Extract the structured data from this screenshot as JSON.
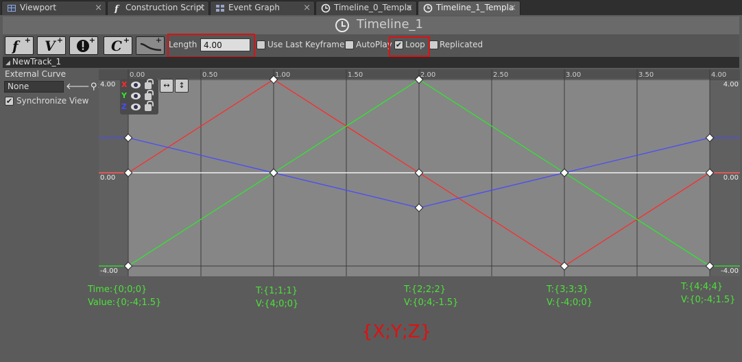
{
  "tabs": [
    {
      "label": "Viewport",
      "icon": "viewport-icon",
      "closable": true,
      "active": false
    },
    {
      "label": "Construction Script",
      "icon": "function-icon",
      "closable": true,
      "active": false
    },
    {
      "label": "Event Graph",
      "icon": "graph-icon",
      "closable": true,
      "active": false
    },
    {
      "label": "Timeline_0_Templa",
      "icon": "clock-icon",
      "closable": true,
      "active": false
    },
    {
      "label": "Timeline_1_Templa",
      "icon": "clock-icon",
      "closable": true,
      "active": true
    }
  ],
  "title": "Timeline_1",
  "toolbar": {
    "buttons": [
      {
        "glyph": "f",
        "icon": "add-float-track-icon"
      },
      {
        "glyph": "V",
        "icon": "add-vector-track-icon"
      },
      {
        "glyph": "!",
        "icon": "add-event-track-icon"
      },
      {
        "glyph": "C",
        "icon": "add-color-track-icon"
      },
      {
        "glyph": "",
        "icon": "add-external-curve-icon"
      }
    ],
    "length_label": "Length",
    "length_value": "4.00",
    "use_last_keyframe_label": "Use Last Keyframe?",
    "use_last_keyframe": false,
    "autoplay_label": "AutoPlay",
    "autoplay": false,
    "loop_label": "Loop",
    "loop": true,
    "replicated_label": "Replicated",
    "replicated": false
  },
  "track": {
    "name": "NewTrack_1",
    "external_curve_label": "External Curve",
    "external_curve_value": "None",
    "sync_view_label": "Synchronize View",
    "sync_view": true
  },
  "axis_toggles": [
    {
      "label": "X",
      "color": "#ff2a2a"
    },
    {
      "label": "Y",
      "color": "#2ee82e"
    },
    {
      "label": "Z",
      "color": "#4a4aff"
    }
  ],
  "chart_data": {
    "type": "line",
    "x_ticks": [
      "0.00",
      "0.50",
      "1.00",
      "1.50",
      "2.00",
      "2.50",
      "3.00",
      "3.50",
      "4.00"
    ],
    "y_ticks_left": [
      "4.00",
      "0.00",
      "-4.00"
    ],
    "y_ticks_right": [
      "4.00",
      "0.00",
      "-4.00"
    ],
    "xlim": [
      0,
      4
    ],
    "ylim": [
      -4,
      4
    ],
    "series": [
      {
        "name": "X",
        "color": "#ff2a2a",
        "x": [
          0,
          1,
          2,
          3,
          4
        ],
        "y": [
          0,
          4,
          0,
          -4,
          0
        ]
      },
      {
        "name": "Y",
        "color": "#2ee82e",
        "x": [
          0,
          1,
          2,
          3,
          4
        ],
        "y": [
          -4,
          0,
          4,
          0,
          -4
        ]
      },
      {
        "name": "Z",
        "color": "#4a4aff",
        "x": [
          0,
          1,
          2,
          3,
          4
        ],
        "y": [
          1.5,
          0,
          -1.5,
          0,
          1.5
        ]
      }
    ]
  },
  "annotations": [
    {
      "t": "Time:{0;0;0}",
      "v": "Value:{0;-4;1.5}"
    },
    {
      "t": "T:{1;1;1}",
      "v": "V:{4;0;0}"
    },
    {
      "t": "T:{2;2;2}",
      "v": "V:{0;4;-1.5}"
    },
    {
      "t": "T:{3;3;3}",
      "v": "V:{-4;0;0}"
    },
    {
      "t": "T:{4;4;4}",
      "v": "V:{0;-4;1.5}"
    }
  ],
  "xyz_label": "{X;Y;Z}",
  "colors": {
    "annotation_green": "#4de23a",
    "highlight_red": "#e01010"
  }
}
